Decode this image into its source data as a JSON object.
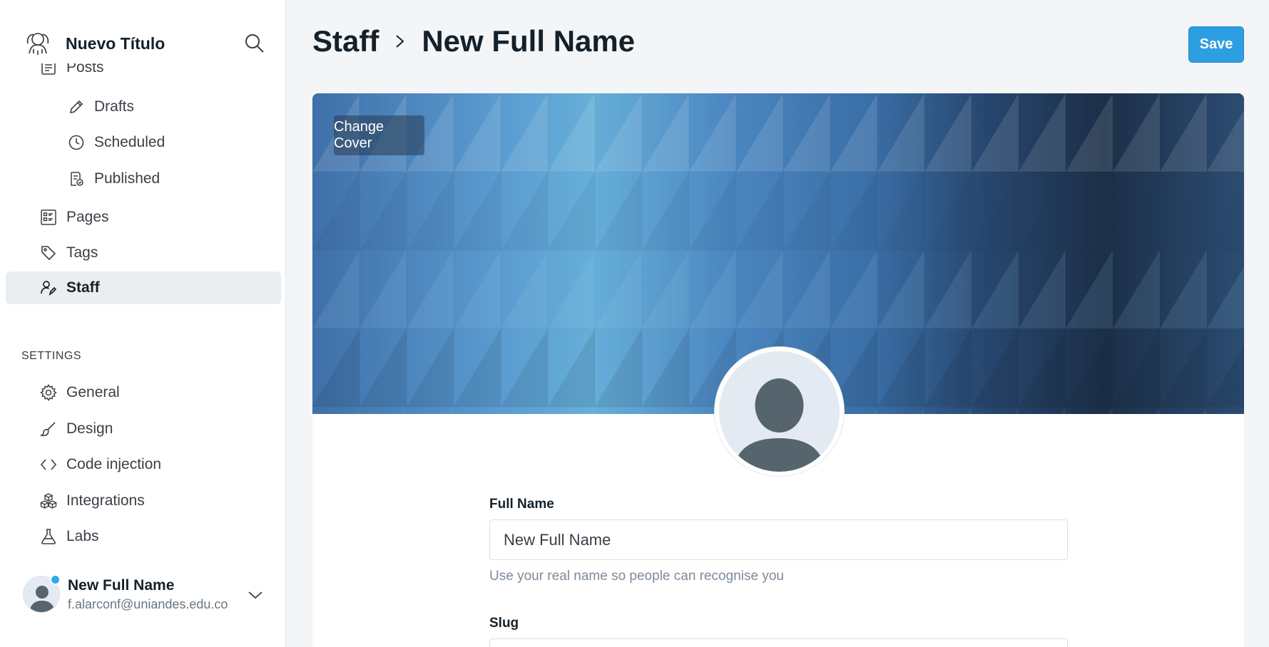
{
  "sidebar": {
    "brand_title": "Nuevo Título",
    "posts_label": "Posts",
    "drafts_label": "Drafts",
    "scheduled_label": "Scheduled",
    "published_label": "Published",
    "pages_label": "Pages",
    "tags_label": "Tags",
    "staff_label": "Staff",
    "settings_heading": "SETTINGS",
    "general_label": "General",
    "design_label": "Design",
    "code_injection_label": "Code injection",
    "integrations_label": "Integrations",
    "labs_label": "Labs",
    "user": {
      "name": "New Full Name",
      "email": "f.alarconf@uniandes.edu.co"
    }
  },
  "header": {
    "breadcrumb_parent": "Staff",
    "breadcrumb_current": "New Full Name",
    "save_label": "Save"
  },
  "profile": {
    "change_cover_label": "Change Cover",
    "full_name_label": "Full Name",
    "full_name_value": "New Full Name",
    "full_name_hint": "Use your real name so people can recognise you",
    "slug_label": "Slug"
  },
  "colors": {
    "accent": "#2d9ee2",
    "active_nav_bg": "#ebeef0",
    "notification_dot": "#30a9ee"
  }
}
